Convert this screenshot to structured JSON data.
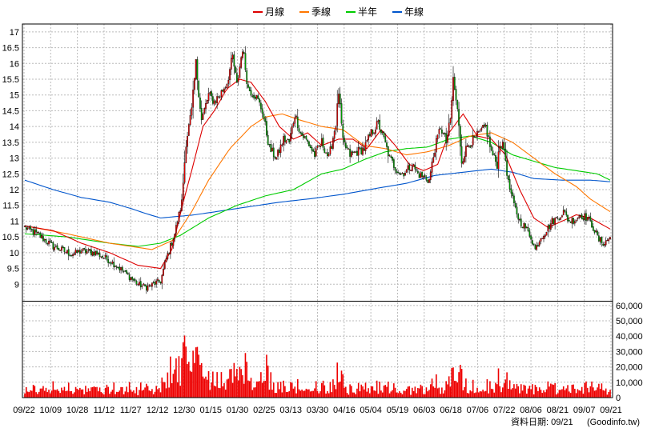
{
  "footer": {
    "date_label": "資料日期: 09/21",
    "source": "(Goodinfo.tw)"
  },
  "colors": {
    "up": "#dd0000",
    "down": "#009900",
    "month": "#dd0000",
    "quarter": "#ff7700",
    "half": "#00cc00",
    "year": "#0055cc",
    "volume": "#ee0000"
  },
  "chart_data": {
    "type": "candlestick",
    "legend": [
      {
        "name": "月線",
        "color": "#dd0000"
      },
      {
        "name": "季線",
        "color": "#ff7700"
      },
      {
        "name": "半年",
        "color": "#00cc00"
      },
      {
        "name": "年線",
        "color": "#0055cc"
      }
    ],
    "price_axis": {
      "labels": [
        "17",
        "16.5",
        "16",
        "15.5",
        "15",
        "14.5",
        "14",
        "13.5",
        "13",
        "12.5",
        "12",
        "11.5",
        "11",
        "10.5",
        "10",
        "9.5",
        "9"
      ],
      "values": [
        17,
        16.5,
        16,
        15.5,
        15,
        14.5,
        14,
        13.5,
        13,
        12.5,
        12,
        11.5,
        11,
        10.5,
        10,
        9.5,
        9
      ],
      "ylim": [
        8.5,
        17.25
      ]
    },
    "volume_axis": {
      "labels": [
        "60,000",
        "50,000",
        "40,000",
        "30,000",
        "20,000",
        "10,000",
        "0"
      ],
      "values": [
        60000,
        50000,
        40000,
        30000,
        20000,
        10000,
        0
      ],
      "ylim": [
        0,
        62000
      ]
    },
    "x_ticks": [
      "09/22",
      "10/09",
      "10/28",
      "11/12",
      "11/27",
      "12/12",
      "12/30",
      "01/15",
      "01/30",
      "02/25",
      "03/13",
      "03/30",
      "04/16",
      "05/04",
      "05/19",
      "06/03",
      "06/18",
      "07/06",
      "07/22",
      "08/06",
      "08/21",
      "09/07",
      "09/21"
    ],
    "close_path": [
      [
        0,
        10.8
      ],
      [
        10,
        10.55
      ],
      [
        20,
        10.2
      ],
      [
        33,
        9.95
      ],
      [
        40,
        10.05
      ],
      [
        50,
        10
      ],
      [
        60,
        9.75
      ],
      [
        70,
        9.4
      ],
      [
        80,
        9.0
      ],
      [
        86,
        8.9
      ],
      [
        93,
        9.05
      ],
      [
        96,
        9.1
      ],
      [
        100,
        9.8
      ],
      [
        106,
        10.6
      ],
      [
        111,
        11.6
      ],
      [
        114,
        13.5
      ],
      [
        118,
        14.5
      ],
      [
        121,
        16.0
      ],
      [
        125,
        14.2
      ],
      [
        130,
        15.0
      ],
      [
        134,
        14.8
      ],
      [
        138,
        15.0
      ],
      [
        143,
        15.4
      ],
      [
        147,
        16.2
      ],
      [
        150,
        15.3
      ],
      [
        154,
        16.5
      ],
      [
        158,
        15.2
      ],
      [
        163,
        15.0
      ],
      [
        168,
        14.5
      ],
      [
        173,
        13.3
      ],
      [
        178,
        13.0
      ],
      [
        183,
        13.6
      ],
      [
        187,
        13.5
      ],
      [
        191,
        14.4
      ],
      [
        195,
        13.8
      ],
      [
        200,
        13.5
      ],
      [
        205,
        13.1
      ],
      [
        210,
        13.5
      ],
      [
        215,
        13.0
      ],
      [
        220,
        14.1
      ],
      [
        222,
        15.1
      ],
      [
        225,
        13.5
      ],
      [
        230,
        13.1
      ],
      [
        235,
        13.2
      ],
      [
        240,
        13.3
      ],
      [
        245,
        13.8
      ],
      [
        250,
        14.1
      ],
      [
        254,
        13.6
      ],
      [
        258,
        13.0
      ],
      [
        262,
        12.7
      ],
      [
        266,
        12.5
      ],
      [
        270,
        12.6
      ],
      [
        274,
        12.8
      ],
      [
        278,
        12.5
      ],
      [
        282,
        12.4
      ],
      [
        286,
        12.3
      ],
      [
        290,
        13.3
      ],
      [
        294,
        14.0
      ],
      [
        298,
        13.5
      ],
      [
        301,
        14.2
      ],
      [
        303,
        15.5
      ],
      [
        306,
        14.5
      ],
      [
        309,
        12.9
      ],
      [
        313,
        13.4
      ],
      [
        318,
        13.6
      ],
      [
        322,
        13.8
      ],
      [
        326,
        14.0
      ],
      [
        330,
        13.2
      ],
      [
        334,
        12.8
      ],
      [
        336,
        13.5
      ],
      [
        339,
        13.3
      ],
      [
        342,
        12.2
      ],
      [
        346,
        11.5
      ],
      [
        350,
        11.0
      ],
      [
        354,
        10.8
      ],
      [
        358,
        10.5
      ],
      [
        361,
        10.1
      ],
      [
        365,
        10.5
      ],
      [
        369,
        10.7
      ],
      [
        373,
        11.0
      ],
      [
        377,
        11.1
      ],
      [
        381,
        11.3
      ],
      [
        385,
        11.0
      ],
      [
        389,
        11.05
      ],
      [
        393,
        11.2
      ],
      [
        398,
        11.1
      ],
      [
        402,
        10.8
      ],
      [
        406,
        10.4
      ],
      [
        410,
        10.3
      ],
      [
        414,
        10.5
      ]
    ],
    "month_line": [
      [
        0,
        10.85
      ],
      [
        20,
        10.7
      ],
      [
        40,
        10.3
      ],
      [
        60,
        10
      ],
      [
        80,
        9.6
      ],
      [
        96,
        9.5
      ],
      [
        104,
        10.1
      ],
      [
        112,
        11.6
      ],
      [
        118,
        12.6
      ],
      [
        126,
        14.0
      ],
      [
        134,
        14.5
      ],
      [
        143,
        15.2
      ],
      [
        152,
        15.5
      ],
      [
        160,
        15.4
      ],
      [
        170,
        14.8
      ],
      [
        180,
        14.0
      ],
      [
        190,
        13.6
      ],
      [
        200,
        13.8
      ],
      [
        210,
        13.4
      ],
      [
        222,
        13.6
      ],
      [
        232,
        13.6
      ],
      [
        242,
        13.3
      ],
      [
        252,
        13.9
      ],
      [
        262,
        13.4
      ],
      [
        272,
        12.8
      ],
      [
        282,
        12.6
      ],
      [
        292,
        12.8
      ],
      [
        300,
        13.8
      ],
      [
        310,
        14.4
      ],
      [
        320,
        13.7
      ],
      [
        330,
        13.6
      ],
      [
        340,
        13.1
      ],
      [
        350,
        12.0
      ],
      [
        360,
        11.1
      ],
      [
        370,
        10.8
      ],
      [
        380,
        11.0
      ],
      [
        390,
        11.2
      ],
      [
        400,
        11.1
      ],
      [
        414,
        10.75
      ]
    ],
    "quarter_line": [
      [
        0,
        10.85
      ],
      [
        30,
        10.6
      ],
      [
        60,
        10.3
      ],
      [
        90,
        10.1
      ],
      [
        105,
        10.4
      ],
      [
        118,
        11.3
      ],
      [
        130,
        12.3
      ],
      [
        145,
        13.3
      ],
      [
        160,
        14.0
      ],
      [
        170,
        14.3
      ],
      [
        182,
        14.4
      ],
      [
        195,
        14.2
      ],
      [
        210,
        14.0
      ],
      [
        225,
        13.9
      ],
      [
        240,
        13.4
      ],
      [
        255,
        13.3
      ],
      [
        270,
        13.1
      ],
      [
        285,
        13.2
      ],
      [
        300,
        13.4
      ],
      [
        315,
        13.7
      ],
      [
        330,
        13.8
      ],
      [
        345,
        13.5
      ],
      [
        360,
        13.0
      ],
      [
        375,
        12.5
      ],
      [
        390,
        12.1
      ],
      [
        400,
        11.7
      ],
      [
        414,
        11.3
      ]
    ],
    "half_line": [
      [
        0,
        10.6
      ],
      [
        30,
        10.5
      ],
      [
        60,
        10.3
      ],
      [
        80,
        10.2
      ],
      [
        96,
        10.3
      ],
      [
        110,
        10.55
      ],
      [
        130,
        11.1
      ],
      [
        150,
        11.5
      ],
      [
        170,
        11.8
      ],
      [
        190,
        12.0
      ],
      [
        210,
        12.5
      ],
      [
        225,
        12.65
      ],
      [
        240,
        12.95
      ],
      [
        255,
        13.2
      ],
      [
        270,
        13.3
      ],
      [
        285,
        13.35
      ],
      [
        300,
        13.6
      ],
      [
        315,
        13.7
      ],
      [
        330,
        13.5
      ],
      [
        345,
        13.1
      ],
      [
        360,
        12.9
      ],
      [
        375,
        12.7
      ],
      [
        390,
        12.6
      ],
      [
        405,
        12.5
      ],
      [
        414,
        12.3
      ]
    ],
    "year_line": [
      [
        0,
        12.3
      ],
      [
        20,
        12.0
      ],
      [
        40,
        11.75
      ],
      [
        60,
        11.6
      ],
      [
        75,
        11.4
      ],
      [
        85,
        11.25
      ],
      [
        96,
        11.1
      ],
      [
        120,
        11.2
      ],
      [
        150,
        11.4
      ],
      [
        180,
        11.6
      ],
      [
        200,
        11.7
      ],
      [
        225,
        11.85
      ],
      [
        250,
        12.05
      ],
      [
        270,
        12.2
      ],
      [
        290,
        12.45
      ],
      [
        310,
        12.55
      ],
      [
        330,
        12.65
      ],
      [
        345,
        12.55
      ],
      [
        360,
        12.35
      ],
      [
        380,
        12.3
      ],
      [
        400,
        12.3
      ],
      [
        414,
        12.25
      ]
    ]
  }
}
